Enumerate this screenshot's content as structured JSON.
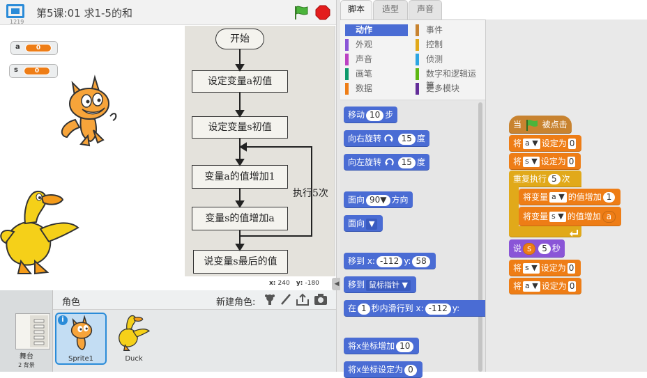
{
  "project": {
    "title": "第5课:01 求1-5的和",
    "version": "1219"
  },
  "monitors": [
    {
      "name": "a",
      "value": "0"
    },
    {
      "name": "s",
      "value": "0"
    }
  ],
  "flowchart": {
    "start": "开始",
    "steps": [
      "设定变量a初值",
      "设定变量s初值",
      "变量a的值增加1",
      "变量s的值增加a",
      "说变量s最后的值"
    ],
    "loop_label": "执行5次"
  },
  "coords": {
    "x_label": "x:",
    "x_value": "240",
    "y_label": "y:",
    "y_value": "-180"
  },
  "sprite_pane": {
    "title": "角色",
    "new_sprite": "新建角色:",
    "stage_label": "舞台",
    "stage_backdrops": "2 背景",
    "sprites": [
      {
        "name": "Sprite1"
      },
      {
        "name": "Duck"
      }
    ]
  },
  "tabs": [
    "脚本",
    "造型",
    "声音"
  ],
  "categories": {
    "left": [
      {
        "label": "动作",
        "color": "#4a6cd4",
        "selected": true
      },
      {
        "label": "外观",
        "color": "#8a55d7"
      },
      {
        "label": "声音",
        "color": "#bb42c3"
      },
      {
        "label": "画笔",
        "color": "#0e9a6c"
      },
      {
        "label": "数据",
        "color": "#ee7d16"
      }
    ],
    "right": [
      {
        "label": "事件",
        "color": "#c88330"
      },
      {
        "label": "控制",
        "color": "#e1a91a"
      },
      {
        "label": "侦测",
        "color": "#2ca5e2"
      },
      {
        "label": "数字和逻辑运算",
        "color": "#5cb712"
      },
      {
        "label": "更多模块",
        "color": "#632d99"
      }
    ]
  },
  "palette": {
    "move": {
      "a": "移动",
      "n": "10",
      "b": "步"
    },
    "turn_right": {
      "a": "向右旋转",
      "n": "15",
      "b": "度"
    },
    "turn_left": {
      "a": "向左旋转",
      "n": "15",
      "b": "度"
    },
    "point_dir": {
      "a": "面向",
      "n": "90▼",
      "b": "方向"
    },
    "point_towards": {
      "a": "面向",
      "d": "▼"
    },
    "goto_xy": {
      "a": "移到 x:",
      "x": "-112",
      "yl": "y:",
      "y": "58"
    },
    "goto_target": {
      "a": "移到",
      "d": "鼠标指针 ▼"
    },
    "glide": {
      "a": "在",
      "n": "1",
      "b": "秒内滑行到 x:",
      "x": "-112",
      "yl": "y:"
    },
    "change_x": {
      "a": "将x坐标增加",
      "n": "10"
    },
    "set_x": {
      "a": "将x坐标设定为",
      "n": "0"
    }
  },
  "script": {
    "hat": {
      "a": "当",
      "b": "被点击"
    },
    "set1": {
      "a": "将",
      "v": "a ▼",
      "b": "设定为",
      "n": "0"
    },
    "set2": {
      "a": "将",
      "v": "s ▼",
      "b": "设定为",
      "n": "0"
    },
    "repeat": {
      "a": "重复执行",
      "n": "5",
      "b": "次"
    },
    "change_a": {
      "a": "将变量",
      "v": "a ▼",
      "b": "的值增加",
      "n": "1"
    },
    "change_s": {
      "a": "将变量",
      "v": "s ▼",
      "b": "的值增加",
      "r": "a"
    },
    "say": {
      "a": "说",
      "r": "s",
      "n": "5",
      "b": "秒"
    },
    "set3": {
      "a": "将",
      "v": "s ▼",
      "b": "设定为",
      "n": "0"
    },
    "set4": {
      "a": "将",
      "v": "a ▼",
      "b": "设定为",
      "n": "0"
    }
  }
}
